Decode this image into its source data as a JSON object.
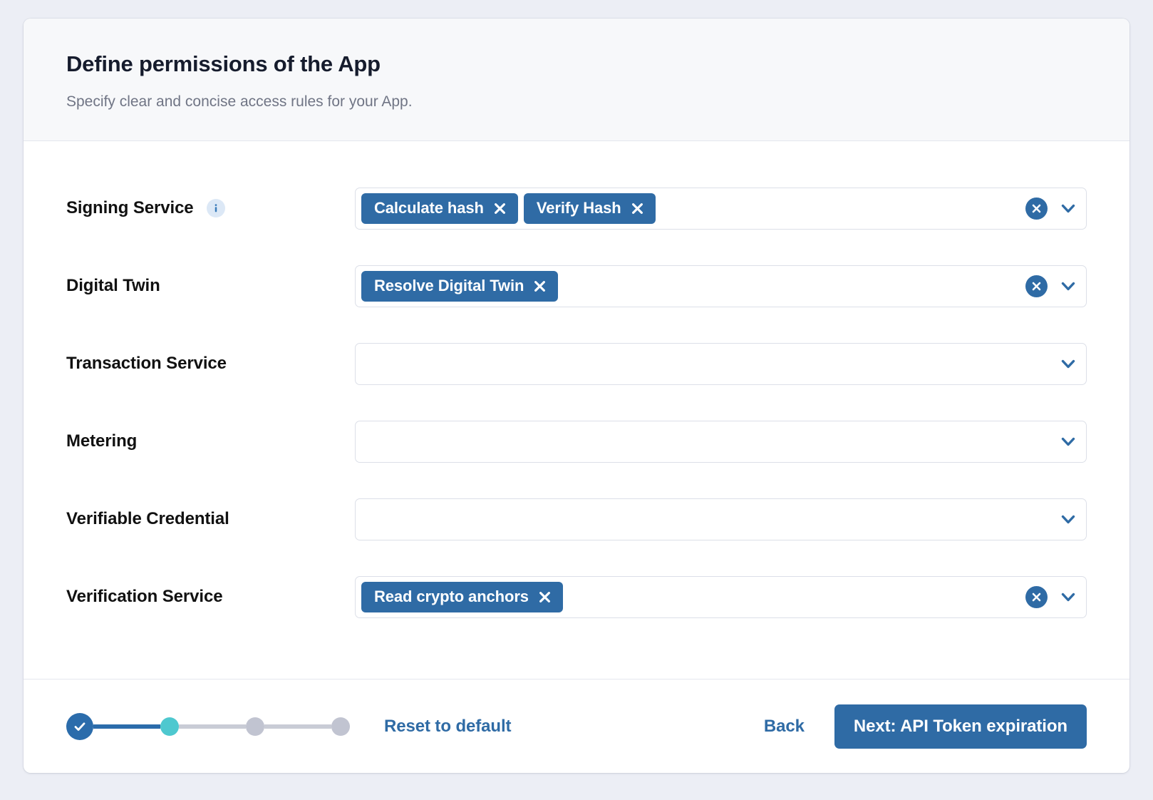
{
  "header": {
    "title": "Define permissions of the App",
    "subtitle": "Specify clear and concise access rules for your App."
  },
  "colors": {
    "accent": "#2f6ba5",
    "tag_bg": "#2f6ba5",
    "step_done": "#2b6cab",
    "step_current": "#4ec8cf",
    "step_todo": "#c1c4d1",
    "page_bg": "#eceef5",
    "header_bg": "#f7f8fa",
    "border": "#dcdfe8",
    "info_icon_bg": "#dce8f6"
  },
  "permissions": [
    {
      "label": "Signing Service",
      "has_info": true,
      "info_icon": "info-circle-icon",
      "tags": [
        "Calculate hash",
        "Verify Hash"
      ],
      "has_clear": true,
      "clear_icon": "clear-circle-icon",
      "chevron_icon": "chevron-down-icon"
    },
    {
      "label": "Digital Twin",
      "has_info": false,
      "tags": [
        "Resolve Digital Twin"
      ],
      "has_clear": true,
      "clear_icon": "clear-circle-icon",
      "chevron_icon": "chevron-down-icon"
    },
    {
      "label": "Transaction Service",
      "has_info": false,
      "tags": [],
      "has_clear": false,
      "chevron_icon": "chevron-down-icon"
    },
    {
      "label": "Metering",
      "has_info": false,
      "tags": [],
      "has_clear": false,
      "chevron_icon": "chevron-down-icon"
    },
    {
      "label": "Verifiable Credential",
      "has_info": false,
      "tags": [],
      "has_clear": false,
      "chevron_icon": "chevron-down-icon"
    },
    {
      "label": "Verification Service",
      "has_info": false,
      "tags": [
        "Read crypto anchors"
      ],
      "has_clear": true,
      "clear_icon": "clear-circle-icon",
      "chevron_icon": "chevron-down-icon"
    }
  ],
  "footer": {
    "steps": [
      {
        "state": "done",
        "icon": "check-icon"
      },
      {
        "state": "current"
      },
      {
        "state": "todo"
      },
      {
        "state": "todo"
      }
    ],
    "reset_label": "Reset to default",
    "back_label": "Back",
    "next_label": "Next: API Token expiration"
  }
}
